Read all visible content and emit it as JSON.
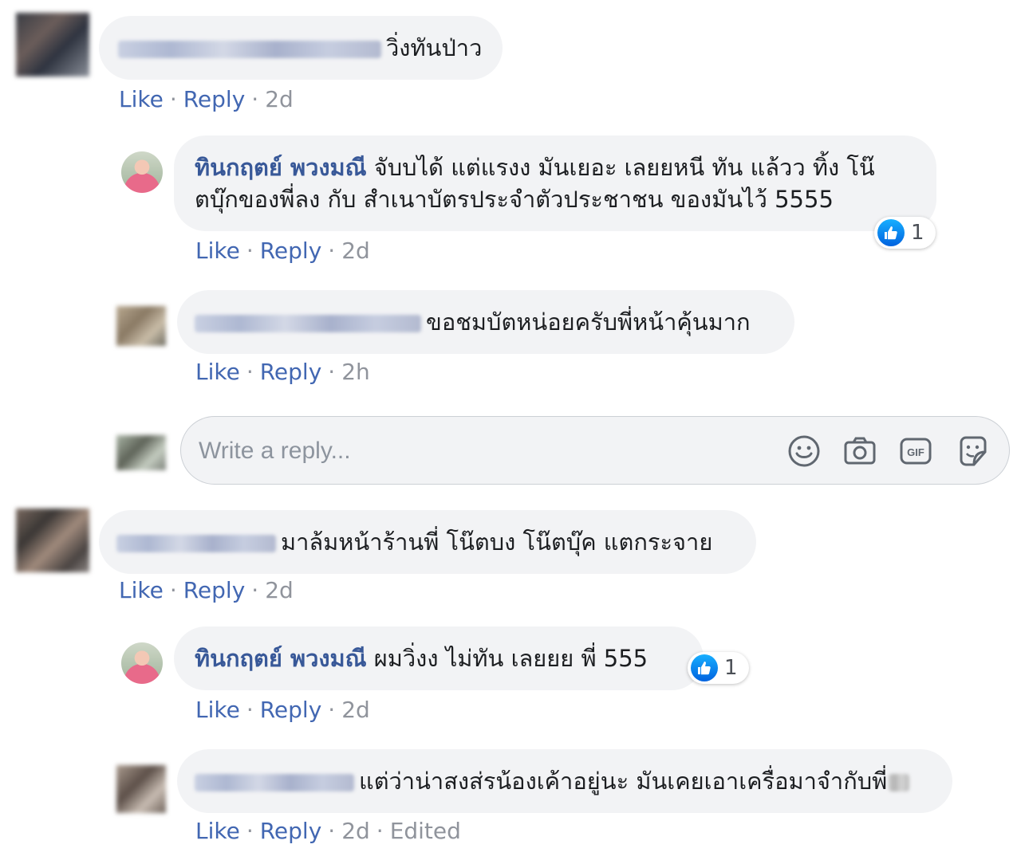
{
  "comments": [
    {
      "text": "วิ่งทันป่าว",
      "actions": {
        "like": "Like",
        "reply": "Reply",
        "time": "2d"
      }
    },
    {
      "name": "ทินกฤตย์ พวงมณี",
      "text_line1": "จับบได้ แต่แรงง มันเยอะ เลยยหนี ทัน แล้วว ทิ้ง โน๊",
      "text_line2": "ตบุ๊กของพี่ลง กับ สำเนาบัตรประจำตัวประชาชน ของมันไว้ 5555",
      "reaction_count": "1",
      "actions": {
        "like": "Like",
        "reply": "Reply",
        "time": "2d"
      }
    },
    {
      "text": "ขอชมบัตหน่อยครับพี่หน้าคุ้นมาก",
      "actions": {
        "like": "Like",
        "reply": "Reply",
        "time": "2h"
      }
    },
    {
      "text": "มาล้มหน้าร้านพี่ โน๊ตบง โน๊ตบุ๊ค แตกระจาย",
      "actions": {
        "like": "Like",
        "reply": "Reply",
        "time": "2d"
      }
    },
    {
      "name": "ทินกฤตย์ พวงมณี",
      "text": "ผมวิ่งง ไม่ทัน เลยยย พี่ 555",
      "reaction_count": "1",
      "actions": {
        "like": "Like",
        "reply": "Reply",
        "time": "2d"
      }
    },
    {
      "text": "แต่ว่าน่าสงส่รน้องเค้าอยู่นะ มันเคยเอาเครื่อมาจำกับพี่",
      "actions": {
        "like": "Like",
        "reply": "Reply",
        "time": "2d",
        "edited": "Edited"
      }
    }
  ],
  "reply_box": {
    "placeholder": "Write a reply...",
    "icons": [
      "emoji-icon",
      "camera-icon",
      "gif-icon",
      "sticker-icon"
    ]
  },
  "colors": {
    "bubble": "#f2f3f5",
    "name": "#385898",
    "link": "#4267b2",
    "meta": "#90949c",
    "like_blue": "#1877f2"
  }
}
